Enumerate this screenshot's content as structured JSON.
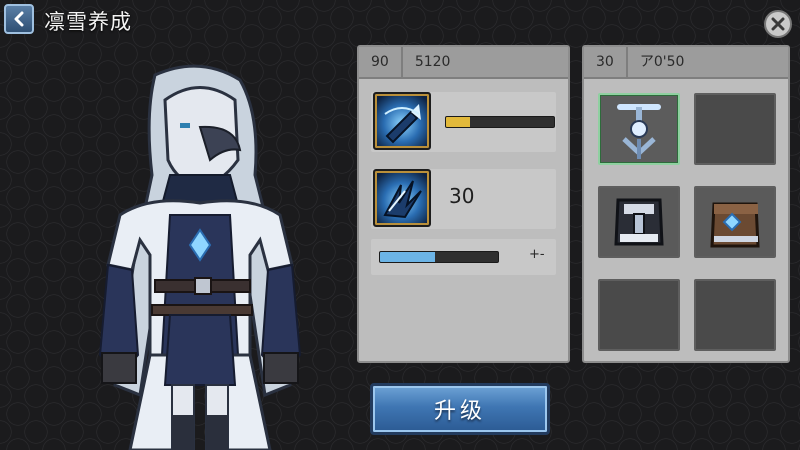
{
  "header": {
    "title": "凛雪养成",
    "back_icon": "chevron-left-icon",
    "close_icon": "close-icon"
  },
  "stats_panel": {
    "level": "90",
    "power": "5120",
    "skill1": {
      "icon": "drill-skill-icon",
      "progress": 0.22,
      "bar_color": "#e2b93b"
    },
    "skill2": {
      "icon": "claw-skill-icon",
      "value": "30"
    },
    "exp": {
      "progress": 0.47,
      "bar_color": "#6cb4e6",
      "label": "+-"
    }
  },
  "equip_panel": {
    "level": "30",
    "name": "ア0'50",
    "slots": [
      {
        "item": "anchor-weapon-icon",
        "filled": true,
        "selected": true
      },
      {
        "item": "",
        "filled": false,
        "selected": false
      },
      {
        "item": "armor-chest-icon",
        "filled": true,
        "selected": false
      },
      {
        "item": "treasure-chest-icon",
        "filled": true,
        "selected": false
      },
      {
        "item": "",
        "filled": false,
        "selected": false
      },
      {
        "item": "",
        "filled": false,
        "selected": false
      }
    ]
  },
  "actions": {
    "upgrade_label": "升级"
  },
  "colors": {
    "accent_blue": "#3f76b3",
    "panel_gray": "#bdbdbd",
    "gold": "#e2b93b"
  }
}
